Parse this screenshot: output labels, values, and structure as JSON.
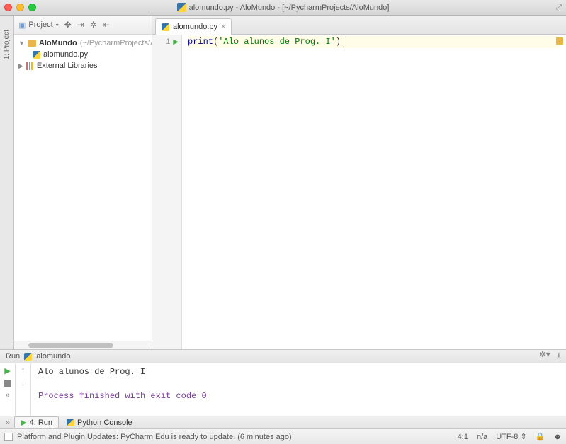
{
  "window": {
    "title": "alomundo.py - AloMundo - [~/PycharmProjects/AloMundo]"
  },
  "leftRail": {
    "toolLabel": "1: Project"
  },
  "projectPanel": {
    "header": "Project",
    "root": {
      "name": "AloMundo",
      "path": "(~/PycharmProjects/AloMundo)"
    },
    "file": "alomundo.py",
    "external": "External Libraries"
  },
  "editor": {
    "tab": "alomundo.py",
    "lineNumber": "1",
    "code": {
      "fn": "print",
      "open": "(",
      "string": "'Alo alunos de Prog. I'",
      "close": ")"
    }
  },
  "run": {
    "title": "Run",
    "config": "alomundo",
    "output1": "Alo alunos de Prog. I",
    "output2": "Process finished with exit code 0"
  },
  "bottomTabs": {
    "run": "4: Run",
    "console": "Python Console"
  },
  "status": {
    "message": "Platform and Plugin Updates: PyCharm Edu is ready to update. (6 minutes ago)",
    "pos": "4:1",
    "insert": "n/a",
    "encoding": "UTF-8"
  }
}
